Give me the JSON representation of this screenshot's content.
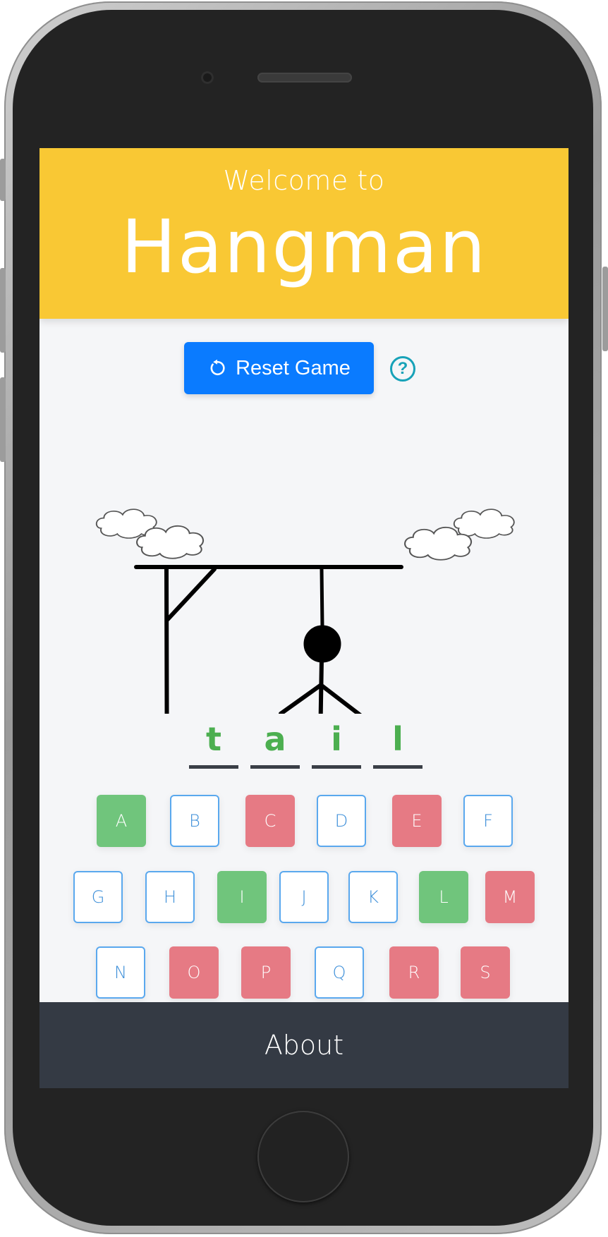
{
  "header": {
    "welcome": "Welcome to",
    "title": "Hangman"
  },
  "controls": {
    "reset_label": "Reset Game",
    "help_label": "?",
    "reset_icon": "refresh-icon",
    "help_icon": "question-circle-icon"
  },
  "word": {
    "letters": [
      "t",
      "a",
      "i",
      "l"
    ]
  },
  "keyboard": {
    "rows": [
      [
        {
          "letter": "A",
          "state": "correct"
        },
        {
          "letter": "B",
          "state": "unused"
        },
        {
          "letter": "C",
          "state": "wrong"
        },
        {
          "letter": "D",
          "state": "unused"
        },
        {
          "letter": "E",
          "state": "wrong"
        },
        {
          "letter": "F",
          "state": "unused"
        }
      ],
      [
        {
          "letter": "G",
          "state": "unused"
        },
        {
          "letter": "H",
          "state": "unused"
        },
        {
          "letter": "I",
          "state": "correct"
        },
        {
          "letter": "J",
          "state": "unused"
        },
        {
          "letter": "K",
          "state": "unused"
        },
        {
          "letter": "L",
          "state": "correct"
        },
        {
          "letter": "M",
          "state": "wrong"
        }
      ],
      [
        {
          "letter": "N",
          "state": "unused"
        },
        {
          "letter": "O",
          "state": "wrong"
        },
        {
          "letter": "P",
          "state": "wrong"
        },
        {
          "letter": "Q",
          "state": "unused"
        },
        {
          "letter": "R",
          "state": "wrong"
        },
        {
          "letter": "S",
          "state": "wrong"
        }
      ]
    ]
  },
  "footer": {
    "about_label": "About"
  },
  "colors": {
    "header": "#f9c834",
    "reset_button": "#0a7bff",
    "correct": "#70c57c",
    "wrong": "#e67a84",
    "unused_border": "#5aa8ee",
    "footer": "#343a44"
  }
}
